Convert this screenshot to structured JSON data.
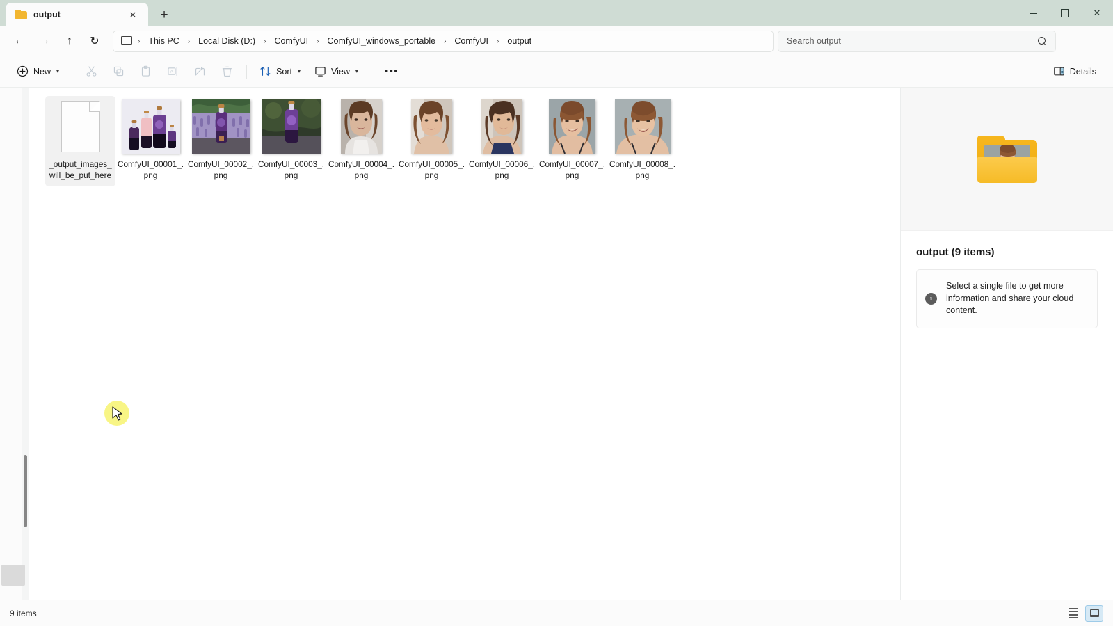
{
  "window": {
    "tab": {
      "title": "output",
      "folder_icon": "folder-icon",
      "close_icon": "close-icon"
    },
    "new_tab_label": "+",
    "controls": {
      "minimize": "minimize-icon",
      "maximize": "maximize-icon",
      "close": "✕"
    }
  },
  "nav": {
    "back_icon": "←",
    "forward_icon": "→",
    "up_icon": "↑",
    "refresh_icon": "↻",
    "breadcrumbs": [
      {
        "label": "This PC"
      },
      {
        "label": "Local Disk (D:)"
      },
      {
        "label": "ComfyUI"
      },
      {
        "label": "ComfyUI_windows_portable"
      },
      {
        "label": "ComfyUI"
      },
      {
        "label": "output"
      }
    ],
    "separator": "›"
  },
  "search": {
    "placeholder": "Search output",
    "value": "",
    "icon": "search-icon"
  },
  "toolbar": {
    "new_label": "New",
    "cut_label": "Cut",
    "copy_label": "Copy",
    "paste_label": "Paste",
    "rename_label": "Rename",
    "share_label": "Share",
    "delete_label": "Delete",
    "sort_label": "Sort",
    "view_label": "View",
    "more_label": "•••",
    "details_label": "Details",
    "caret": "▾"
  },
  "files": [
    {
      "name": "_output_images_will_be_put_here",
      "kind": "document",
      "selected": true
    },
    {
      "name": "ComfyUI_00001_.png",
      "kind": "image-bottles",
      "selected": false
    },
    {
      "name": "ComfyUI_00002_.png",
      "kind": "image-lavender-bottle",
      "selected": false
    },
    {
      "name": "ComfyUI_00003_.png",
      "kind": "image-galaxy-bottle",
      "selected": false
    },
    {
      "name": "ComfyUI_00004_.png",
      "kind": "image-portrait-a",
      "selected": false
    },
    {
      "name": "ComfyUI_00005_.png",
      "kind": "image-portrait-b",
      "selected": false
    },
    {
      "name": "ComfyUI_00006_.png",
      "kind": "image-portrait-c",
      "selected": false
    },
    {
      "name": "ComfyUI_00007_.png",
      "kind": "image-portrait-d",
      "selected": false
    },
    {
      "name": "ComfyUI_00008_.png",
      "kind": "image-portrait-e",
      "selected": false
    }
  ],
  "details_pane": {
    "preview_icon": "folder-with-photo-icon",
    "title": "output (9 items)",
    "info_icon": "i",
    "info_text": "Select a single file to get more information and share your cloud content."
  },
  "status": {
    "item_count": "9 items",
    "list_view_icon": "list-view-icon",
    "tile_view_icon": "tile-view-icon"
  },
  "colors": {
    "titlebar": "#cfdcd4",
    "chrome": "#fbfbfb",
    "accent_selected_view": "#d6e9f5",
    "folder_yellow": "#f6b61d",
    "cursor_highlight": "#f7f36a"
  }
}
